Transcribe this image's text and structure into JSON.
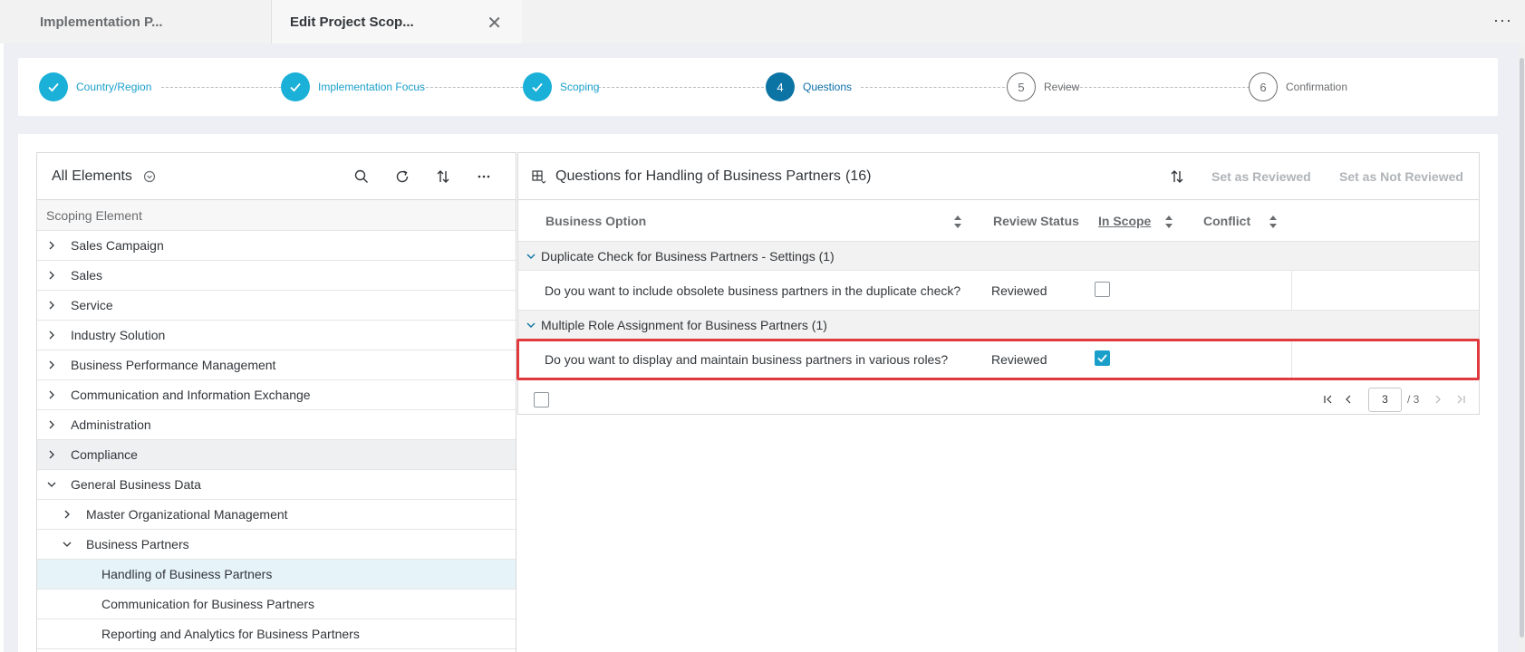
{
  "tabs": [
    {
      "label": "Implementation P..."
    },
    {
      "label": "Edit Project Scop..."
    }
  ],
  "overflow_label": "···",
  "wizard": {
    "steps": [
      {
        "num": "",
        "label": "Country/Region",
        "state": "done"
      },
      {
        "num": "",
        "label": "Implementation Focus",
        "state": "done"
      },
      {
        "num": "",
        "label": "Scoping",
        "state": "done"
      },
      {
        "num": "4",
        "label": "Questions",
        "state": "current"
      },
      {
        "num": "5",
        "label": "Review",
        "state": "future"
      },
      {
        "num": "6",
        "label": "Confirmation",
        "state": "future"
      }
    ]
  },
  "left": {
    "title": "All Elements",
    "column_header": "Scoping Element",
    "rows": [
      {
        "label": "Sales Campaign",
        "level": 0,
        "chevron": "right"
      },
      {
        "label": "Sales",
        "level": 0,
        "chevron": "right"
      },
      {
        "label": "Service",
        "level": 0,
        "chevron": "right"
      },
      {
        "label": "Industry Solution",
        "level": 0,
        "chevron": "right"
      },
      {
        "label": "Business Performance Management",
        "level": 0,
        "chevron": "right"
      },
      {
        "label": "Communication and Information Exchange",
        "level": 0,
        "chevron": "right"
      },
      {
        "label": "Administration",
        "level": 0,
        "chevron": "right"
      },
      {
        "label": "Compliance",
        "level": 0,
        "chevron": "right"
      },
      {
        "label": "General Business Data",
        "level": 0,
        "chevron": "down"
      },
      {
        "label": "Master Organizational Management",
        "level": 1,
        "chevron": "right"
      },
      {
        "label": "Business Partners",
        "level": 1,
        "chevron": "down"
      },
      {
        "label": "Handling of Business Partners",
        "level": 2,
        "chevron": "none"
      },
      {
        "label": "Communication for Business Partners",
        "level": 2,
        "chevron": "none"
      },
      {
        "label": "Reporting and Analytics for Business Partners",
        "level": 2,
        "chevron": "none"
      }
    ]
  },
  "right": {
    "title": "Questions for Handling of Business Partners",
    "count": "(16)",
    "set_reviewed": "Set as Reviewed",
    "set_not_reviewed": "Set as Not Reviewed",
    "columns": {
      "business_option": "Business Option",
      "review_status": "Review Status",
      "in_scope": "In Scope",
      "conflict": "Conflict"
    },
    "groups": [
      {
        "title": "Duplicate Check for Business Partners - Settings (1)",
        "question": "Do you want to include obsolete business partners in the duplicate check?",
        "status": "Reviewed",
        "in_scope": false
      },
      {
        "title": "Multiple Role Assignment for Business Partners (1)",
        "question": "Do you want to display and maintain business partners in various roles?",
        "status": "Reviewed",
        "in_scope": true
      }
    ],
    "pager": {
      "current": "3",
      "total": "/ 3"
    }
  },
  "colors": {
    "accent": "#1a9fcb",
    "current_step": "#0b74a4",
    "highlight_border": "#e0393e"
  }
}
